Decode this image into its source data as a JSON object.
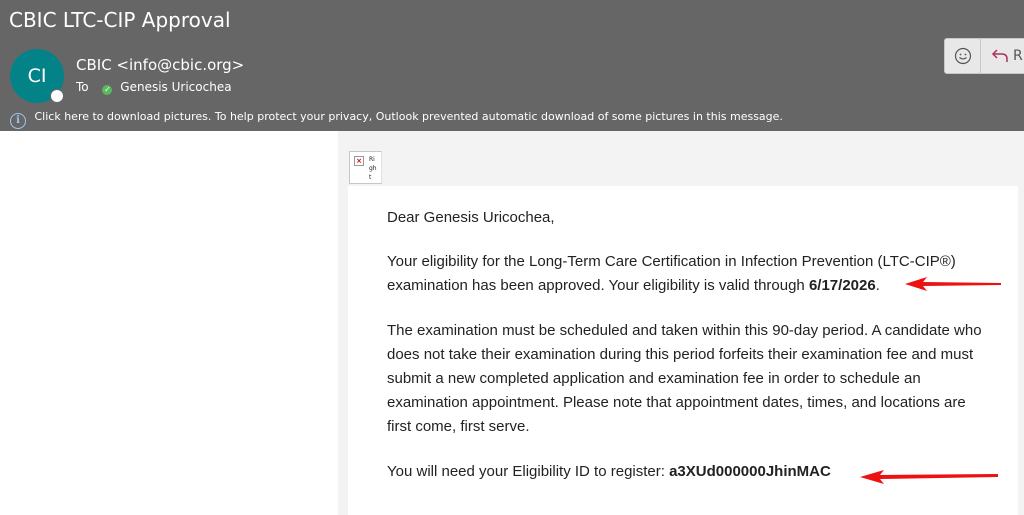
{
  "header": {
    "subject": "CBIC LTC-CIP Approval",
    "avatar_initials": "CI",
    "from": "CBIC <info@cbic.org>",
    "to_label": "To",
    "to_name": "Genesis Uricochea",
    "info_message": "Click here to download pictures. To help protect your privacy, Outlook prevented automatic download of some pictures in this message.",
    "reply_label": "R"
  },
  "image_placeholder": {
    "alt_text": "Right"
  },
  "body": {
    "greeting": "Dear Genesis Uricochea,",
    "para1_text": "Your eligibility for the Long-Term Care Certification in Infection Prevention (LTC-CIP®) examination has been approved. Your eligibility is valid through ",
    "para1_date": "6/17/2026",
    "para1_end": ".",
    "para2": "The examination must be scheduled and taken within this 90-day period. A candidate who does not take their examination during this period forfeits their examination fee and must submit a new completed application and examination fee in order to schedule an examination appointment. Please note that appointment dates, times, and locations are first come, first serve.",
    "para3_text": "You will need your Eligibility ID to register: ",
    "eligibility_id": "a3XUd000000JhinMAC"
  },
  "colors": {
    "header_bg": "#666666",
    "avatar_bg": "#038387",
    "annotation_arrow": "#ee1111"
  }
}
